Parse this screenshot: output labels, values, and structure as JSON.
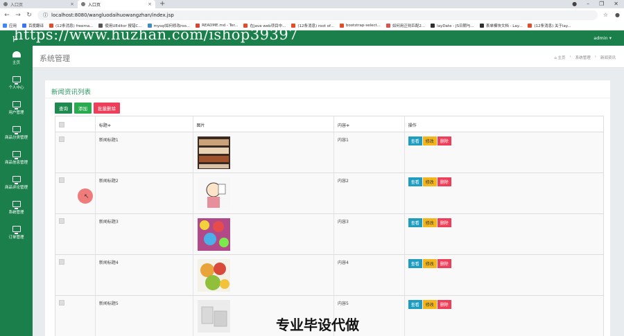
{
  "browser": {
    "tabs": [
      {
        "label": "入口页"
      },
      {
        "label": "入口页"
      }
    ],
    "url": "localhost:8080/wangluodaihuowangzhan/index.jsp",
    "bookmarks": [
      {
        "label": "应用",
        "color": "#4285f4"
      },
      {
        "label": "百度翻译",
        "color": "#3b74f0"
      },
      {
        "label": "(12条消息) freema...",
        "color": "#e14d2a"
      },
      {
        "label": "使用UEditor 报错C...",
        "color": "#555555"
      },
      {
        "label": "mysql如何修改roo...",
        "color": "#3c8dbc"
      },
      {
        "label": "README.md - Ter...",
        "color": "#d44638"
      },
      {
        "label": "在java web项目中...",
        "color": "#e14d2a"
      },
      {
        "label": "(12条消息) root of...",
        "color": "#e14d2a"
      },
      {
        "label": "bootstrap-select...",
        "color": "#e14d2a"
      },
      {
        "label": "如何用正则匹配2...",
        "color": "#d9534f"
      },
      {
        "label": "layDate - JS日期与...",
        "color": "#2f2f2f"
      },
      {
        "label": "表单模块文档 - Lay...",
        "color": "#2f2f2f"
      },
      {
        "label": "(12条消息) 关于lay...",
        "color": "#e14d2a"
      }
    ]
  },
  "app": {
    "logo": "μ",
    "user": "admin ▾",
    "watermark": "https://www.huzhan.com/ishop39397",
    "sidebar": [
      {
        "label": "主页",
        "icon": "gauge-icon"
      },
      {
        "label": "个人中心",
        "icon": "monitor-icon"
      },
      {
        "label": "用户管理",
        "icon": "monitor-icon"
      },
      {
        "label": "商品分类管理",
        "icon": "monitor-icon"
      },
      {
        "label": "商品信息管理",
        "icon": "monitor-icon"
      },
      {
        "label": "商品评论管理",
        "icon": "monitor-icon"
      },
      {
        "label": "系统管理",
        "icon": "monitor-icon"
      },
      {
        "label": "订单管理",
        "icon": "monitor-icon"
      }
    ],
    "page_title": "系统管理",
    "breadcrumb": [
      "⌂ 主页",
      "系统管理",
      "新闻资讯"
    ],
    "panel_title": "新闻资讯列表",
    "actions": {
      "search": "查询",
      "add": "添加",
      "batch_delete": "批量删除"
    },
    "table": {
      "headers": [
        "",
        "标题≑",
        "图片",
        "内容≑",
        "操作"
      ],
      "rows": [
        {
          "title": "新闻标题1",
          "content": "内容1",
          "image": "shelf"
        },
        {
          "title": "新闻标题2",
          "content": "内容2",
          "image": "cartoon"
        },
        {
          "title": "新闻标题3",
          "content": "内容3",
          "image": "candy"
        },
        {
          "title": "新闻标题4",
          "content": "内容4",
          "image": "fruit"
        },
        {
          "title": "新闻标题5",
          "content": "内容5",
          "image": "box"
        }
      ],
      "row_actions": {
        "view": "查看",
        "edit": "修改",
        "delete": "删除"
      }
    },
    "banner": "专业毕设代做"
  }
}
